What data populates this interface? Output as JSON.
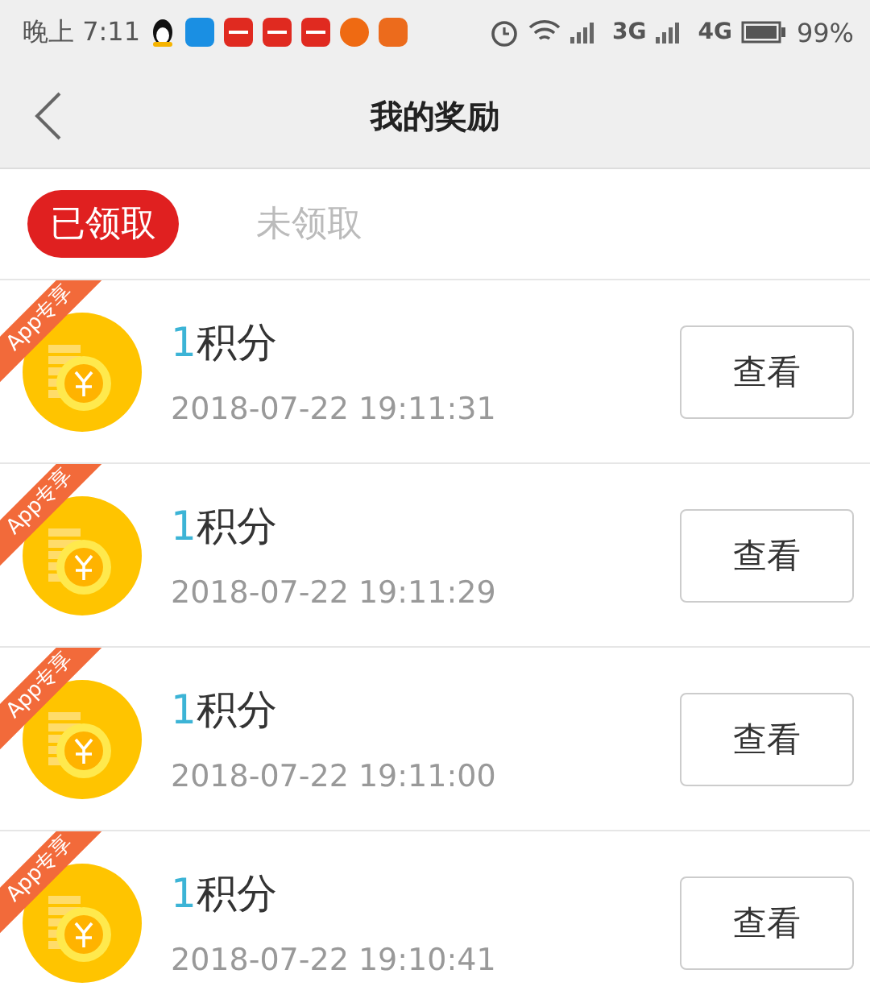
{
  "status_bar": {
    "time": "晚上 7:11",
    "network_1": "3G",
    "network_2": "4G",
    "battery": "99%"
  },
  "header": {
    "title": "我的奖励"
  },
  "tabs": [
    {
      "label": "已领取",
      "selected": true
    },
    {
      "label": "未领取",
      "selected": false
    }
  ],
  "rewards": [
    {
      "ribbon": "App专享",
      "amount": "1",
      "unit": "积分",
      "time": "2018-07-22 19:11:31",
      "button": "查看"
    },
    {
      "ribbon": "App专享",
      "amount": "1",
      "unit": "积分",
      "time": "2018-07-22 19:11:29",
      "button": "查看"
    },
    {
      "ribbon": "App专享",
      "amount": "1",
      "unit": "积分",
      "time": "2018-07-22 19:11:00",
      "button": "查看"
    },
    {
      "ribbon": "App专享",
      "amount": "1",
      "unit": "积分",
      "time": "2018-07-22 19:10:41",
      "button": "查看"
    }
  ]
}
